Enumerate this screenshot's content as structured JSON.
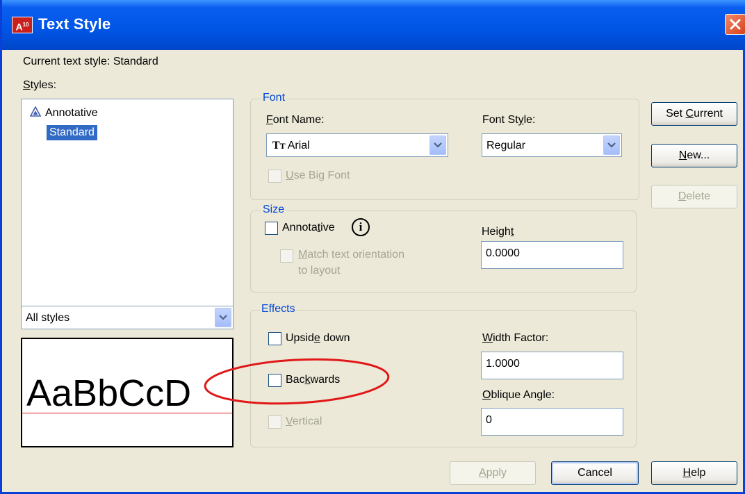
{
  "window": {
    "title": "Text Style",
    "app_badge": "A",
    "app_badge_small": "10"
  },
  "current_style": {
    "label": "Current text style:",
    "value": "Standard"
  },
  "styles": {
    "label_first": "S",
    "label_rest": "tyles:",
    "items": [
      {
        "label": "Annotative",
        "icon": "annotative-icon"
      },
      {
        "label": "Standard",
        "selected": true
      }
    ],
    "filter_value": "All styles",
    "preview_text": "AaBbCcD"
  },
  "font": {
    "group_title": "Font",
    "name_label_u": "F",
    "name_label_rest": "ont Name:",
    "name_value": "Arial",
    "name_icon": "truetype-icon",
    "style_label_pre": "Font St",
    "style_label_u": "y",
    "style_label_rest": "le:",
    "style_value": "Regular",
    "bigfont_label_u": "U",
    "bigfont_label_rest": "se Big Font"
  },
  "size": {
    "group_title": "Size",
    "annotative_pre": "Annota",
    "annotative_u": "t",
    "annotative_rest": "ive",
    "info_icon": "i",
    "match_u": "M",
    "match_rest": "atch text orientation",
    "match_line2": "to layout",
    "height_pre": "Heigh",
    "height_u": "t",
    "height_rest": "",
    "height_value": "0.0000"
  },
  "effects": {
    "group_title": "Effects",
    "upside_pre": "Upsid",
    "upside_u": "e",
    "upside_rest": " down",
    "backwards_pre": "Bac",
    "backwards_u": "k",
    "backwards_rest": "wards",
    "vertical_u": "V",
    "vertical_rest": "ertical",
    "width_u": "W",
    "width_rest": "idth Factor:",
    "width_value": "1.0000",
    "oblique_u": "O",
    "oblique_rest": "blique Angle:",
    "oblique_value": "0"
  },
  "buttons": {
    "set_current_pre": "Set ",
    "set_current_u": "C",
    "set_current_rest": "urrent",
    "new_u": "N",
    "new_rest": "ew...",
    "delete_u": "D",
    "delete_rest": "elete",
    "apply_u": "A",
    "apply_rest": "pply",
    "cancel": "Cancel",
    "help_u": "H",
    "help_rest": "elp"
  },
  "colors": {
    "title_bar": "#0055e5",
    "group_title": "#0046d5",
    "annotation_ellipse": "#e01818",
    "preview_baseline": "#e02020"
  }
}
